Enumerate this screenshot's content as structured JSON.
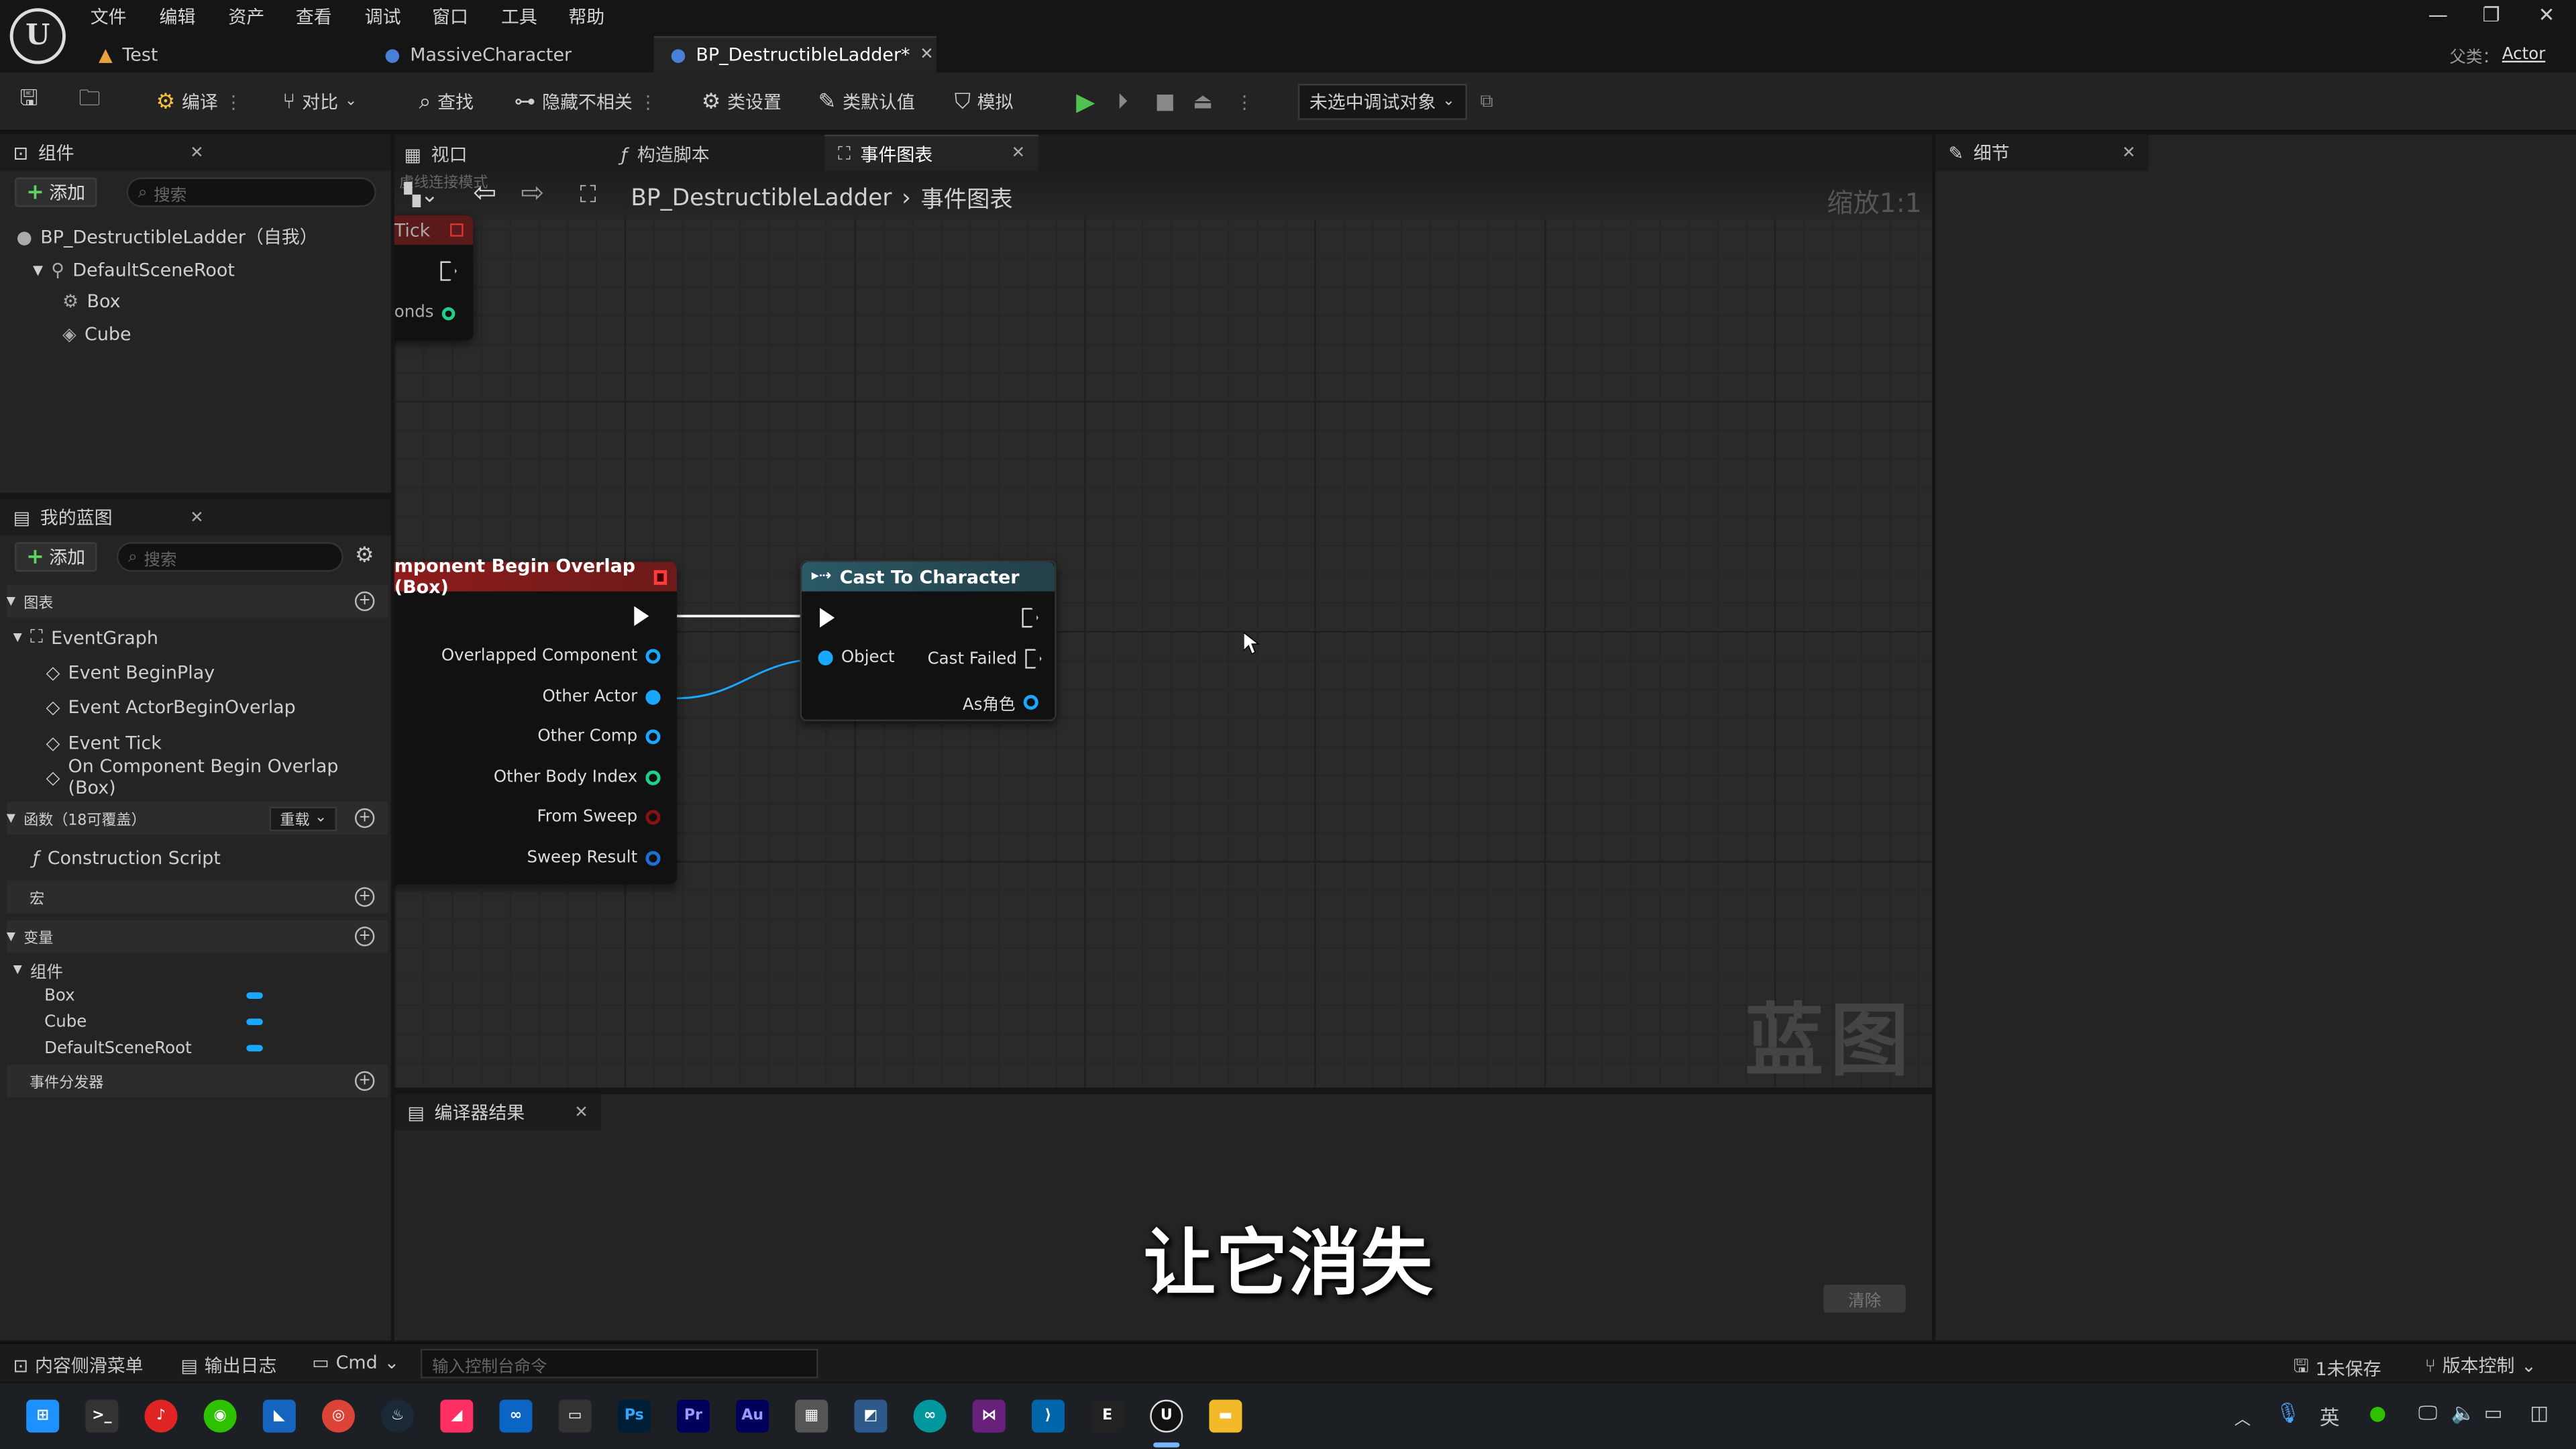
{
  "menu": {
    "items": [
      "文件",
      "编辑",
      "资产",
      "查看",
      "调试",
      "窗口",
      "工具",
      "帮助"
    ]
  },
  "doc_tabs": [
    {
      "label": "Test"
    },
    {
      "label": "MassiveCharacter"
    },
    {
      "label": "BP_DestructibleLadder*"
    }
  ],
  "parent_class": {
    "label": "父类：",
    "value": "Actor"
  },
  "toolbar": {
    "compile": "编译",
    "diff": "对比",
    "find": "查找",
    "hide_unrelated": "隐藏不相关",
    "class_settings": "类设置",
    "class_defaults": "类默认值",
    "simulate": "模拟",
    "debug_object": "未选中调试对象"
  },
  "components_panel": {
    "title": "组件",
    "add": "添加",
    "search_placeholder": "搜索",
    "root": "BP_DestructibleLadder（自我）",
    "items": [
      "DefaultSceneRoot",
      "Box",
      "Cube"
    ]
  },
  "my_blueprint": {
    "title": "我的蓝图",
    "add": "添加",
    "search_placeholder": "搜索",
    "graphs_label": "图表",
    "event_graph": "EventGraph",
    "events": [
      "Event BeginPlay",
      "Event ActorBeginOverlap",
      "Event Tick",
      "On Component Begin Overlap (Box)"
    ],
    "functions_label": "函数（18可覆盖）",
    "override": "重载",
    "construction_script": "Construction Script",
    "macros_label": "宏",
    "variables_label": "变量",
    "components_label": "组件",
    "variables": [
      "Box",
      "Cube",
      "DefaultSceneRoot"
    ],
    "dispatchers_label": "事件分发器"
  },
  "graph_tabs": {
    "viewport": "视口",
    "construction": "构造脚本",
    "event_graph": "事件图表",
    "details": "细节"
  },
  "graph": {
    "breadcrumb_bp": "BP_DestructibleLadder",
    "breadcrumb_graph": "事件图表",
    "zoom": "缩放1:1",
    "faint_hint": "虚线连接模式",
    "watermark": "蓝图",
    "tick_node": {
      "title": "Tick",
      "pin": "onds"
    },
    "overlap_node": {
      "title": "mponent Begin Overlap (Box)",
      "pins": [
        "Overlapped Component",
        "Other Actor",
        "Other Comp",
        "Other Body Index",
        "From Sweep",
        "Sweep Result"
      ]
    },
    "cast_node": {
      "title": "Cast To Character",
      "object": "Object",
      "cast_failed": "Cast Failed",
      "as": "As角色"
    }
  },
  "compiler": {
    "title": "编译器结果",
    "clear": "清除"
  },
  "subtitle": "让它消失",
  "statusbar": {
    "content_drawer": "内容侧滑菜单",
    "output_log": "输出日志",
    "cmd": "Cmd",
    "console_placeholder": "输入控制台命令",
    "unsaved": "1未保存",
    "source_control": "版本控制"
  },
  "tray": {
    "lang": "英"
  },
  "colors": {
    "overlap_header": "#8f1c1c",
    "cast_header": "#2a5966",
    "object_pin": "#1aa7ff",
    "struct_pin": "#1d6fd6",
    "int_pin": "#1fd08b",
    "bool_pin": "#8a1111",
    "accent_play": "#4fc24f"
  },
  "icons": [
    "unreal-logo-icon",
    "save-icon",
    "browse-icon",
    "compile-icon",
    "diff-icon",
    "find-icon",
    "hide-icon",
    "settings-icon",
    "defaults-icon",
    "simulate-icon",
    "play-icon",
    "step-icon",
    "stop-icon",
    "eject-icon"
  ]
}
